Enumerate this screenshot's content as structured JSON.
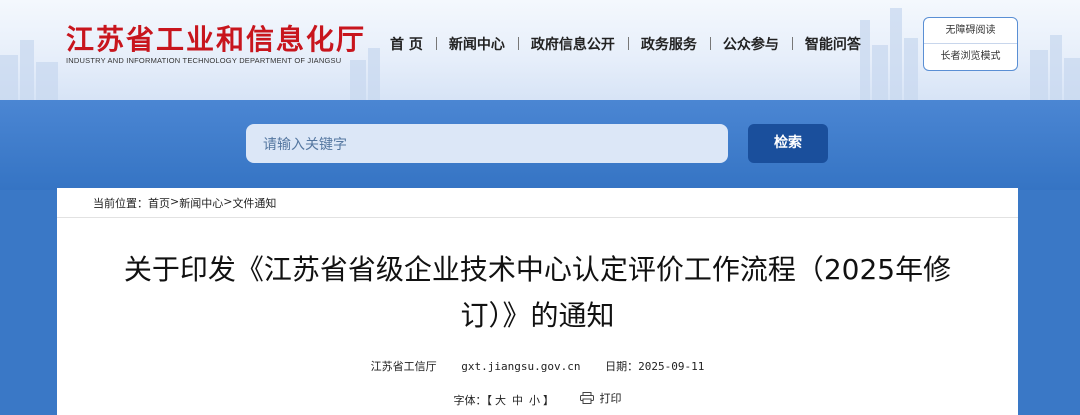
{
  "header": {
    "title": "江苏省工业和信息化厅",
    "subtitle": "INDUSTRY AND INFORMATION TECHNOLOGY DEPARTMENT OF JIANGSU",
    "nav": [
      "首 页",
      "新闻中心",
      "政府信息公开",
      "政务服务",
      "公众参与",
      "智能问答"
    ],
    "accessibility": "无障碍阅读",
    "elder_mode": "长者浏览模式"
  },
  "search": {
    "placeholder": "请输入关键字",
    "button": "检索"
  },
  "breadcrumb": {
    "prefix": "当前位置：",
    "items": [
      "首页",
      ">",
      "新闻中心",
      ">",
      "文件通知"
    ]
  },
  "article": {
    "title_line1": "关于印发《江苏省省级企业技术中心认定评价工作流程（2025年修",
    "title_line2": "订）》的通知",
    "source": "江苏省工信厅",
    "site": "gxt.jiangsu.gov.cn",
    "date": "日期：2025-09-11"
  },
  "tools": {
    "font_label": "字体：【",
    "large": "大",
    "medium": "中",
    "small": "小",
    "close": "】",
    "print": "打印"
  },
  "colors": {
    "brand_red": "#c8151d",
    "accent_blue": "#1a4f9c",
    "background_blue": "#3a78c6"
  }
}
